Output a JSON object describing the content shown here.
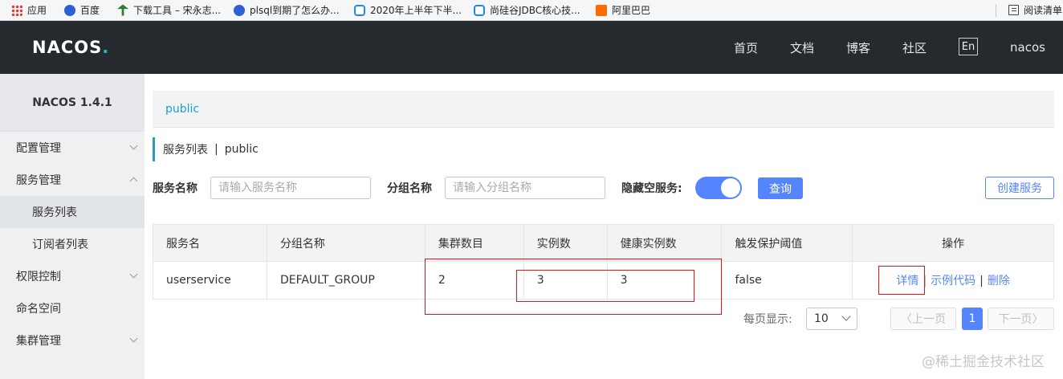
{
  "bookmarks": {
    "items": [
      {
        "label": "应用",
        "icon": "apps-grid-icon"
      },
      {
        "label": "百度",
        "icon": "baidu-paw-icon"
      },
      {
        "label": "下载工具 – 宋永志...",
        "icon": "tool-icon"
      },
      {
        "label": "plsql到期了怎么办...",
        "icon": "baidu-paw-icon"
      },
      {
        "label": "2020年上半年下半...",
        "icon": "tv-icon"
      },
      {
        "label": "尚硅谷JDBC核心技...",
        "icon": "tv-icon"
      },
      {
        "label": "阿里巴巴",
        "icon": "alibaba-icon"
      }
    ],
    "reading_list": "阅读清单"
  },
  "header": {
    "logo": "NACOS",
    "logo_dot": ".",
    "nav": [
      "首页",
      "文档",
      "博客",
      "社区"
    ],
    "lang": "En",
    "user": "nacos"
  },
  "sidebar": {
    "version": "NACOS 1.4.1",
    "items": [
      {
        "label": "配置管理"
      },
      {
        "label": "服务管理"
      },
      {
        "label": "服务列表"
      },
      {
        "label": "订阅者列表"
      },
      {
        "label": "权限控制"
      },
      {
        "label": "命名空间"
      },
      {
        "label": "集群管理"
      }
    ]
  },
  "main": {
    "namespace_tab": "public",
    "title": "服务列表",
    "title_sep": "|",
    "title_ns": "public",
    "filters": {
      "service_name_label": "服务名称",
      "service_name_placeholder": "请输入服务名称",
      "group_name_label": "分组名称",
      "group_name_placeholder": "请输入分组名称",
      "hide_empty_label": "隐藏空服务:",
      "hide_empty_on": true,
      "query_label": "查询",
      "create_label": "创建服务"
    },
    "table": {
      "columns": [
        "服务名",
        "分组名称",
        "集群数目",
        "实例数",
        "健康实例数",
        "触发保护阈值",
        "操作"
      ],
      "rows": [
        {
          "service": "userservice",
          "group": "DEFAULT_GROUP",
          "clusters": "2",
          "instances": "3",
          "healthy": "3",
          "threshold": "false",
          "ops": [
            "详情",
            "示例代码",
            "删除"
          ]
        }
      ]
    },
    "pagination": {
      "per_page_label": "每页显示:",
      "per_page": "10",
      "prev": "上一页",
      "current": "1",
      "next": "下一页"
    }
  },
  "watermark": "@稀土掘金技术社区",
  "colors": {
    "header_bg": "#252a2f",
    "primary": "#5584ff",
    "link": "#1b9fcf",
    "annotation": "#e0141e"
  }
}
